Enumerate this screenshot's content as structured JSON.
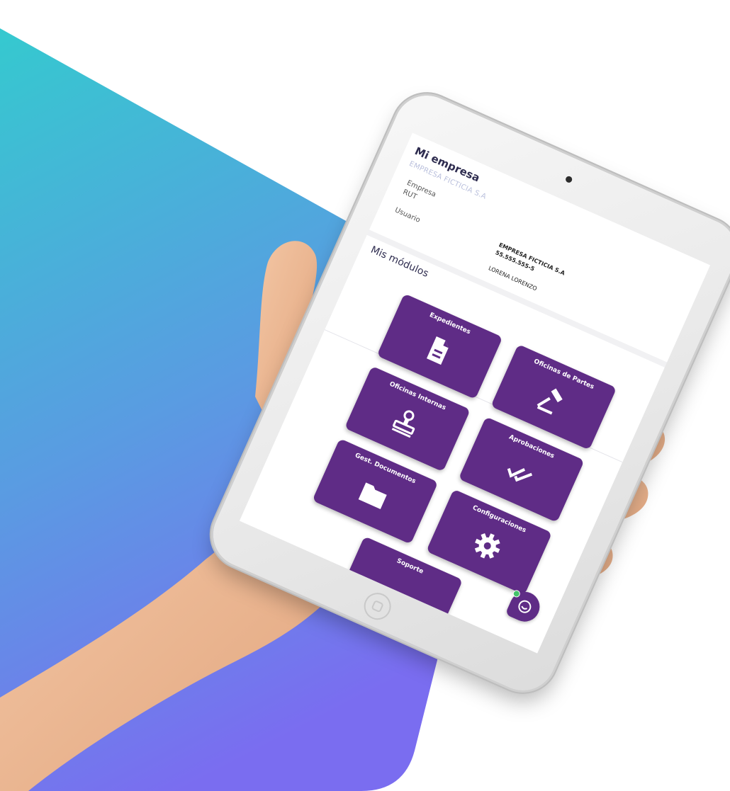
{
  "company": {
    "title": "Mi empresa",
    "subtitle": "EMPRESA FICTICIA S.A",
    "rows": [
      {
        "label": "Empresa",
        "value": "EMPRESA FICTICIA S.A"
      },
      {
        "label": "RUT",
        "value": "55.555.555-5"
      },
      {
        "label": "Usuario",
        "value": "LORENA LORENZO"
      }
    ]
  },
  "modules": {
    "title": "Mis módulos",
    "items": [
      {
        "label": "Expedientes",
        "icon": "document-icon"
      },
      {
        "label": "Oficinas de Partes",
        "icon": "gavel-icon"
      },
      {
        "label": "Oficinas Internas",
        "icon": "stamp-icon"
      },
      {
        "label": "Aprobaciones",
        "icon": "double-check-icon"
      },
      {
        "label": "Gest. Documentos",
        "icon": "folder-icon"
      },
      {
        "label": "Configuraciones",
        "icon": "gear-icon"
      },
      {
        "label": "Soporte",
        "icon": "support-icon"
      }
    ]
  },
  "colors": {
    "tile": "#5f2c86",
    "gradient_top": "#35c9cf",
    "gradient_bottom": "#7a6df0",
    "online": "#44c26b"
  }
}
